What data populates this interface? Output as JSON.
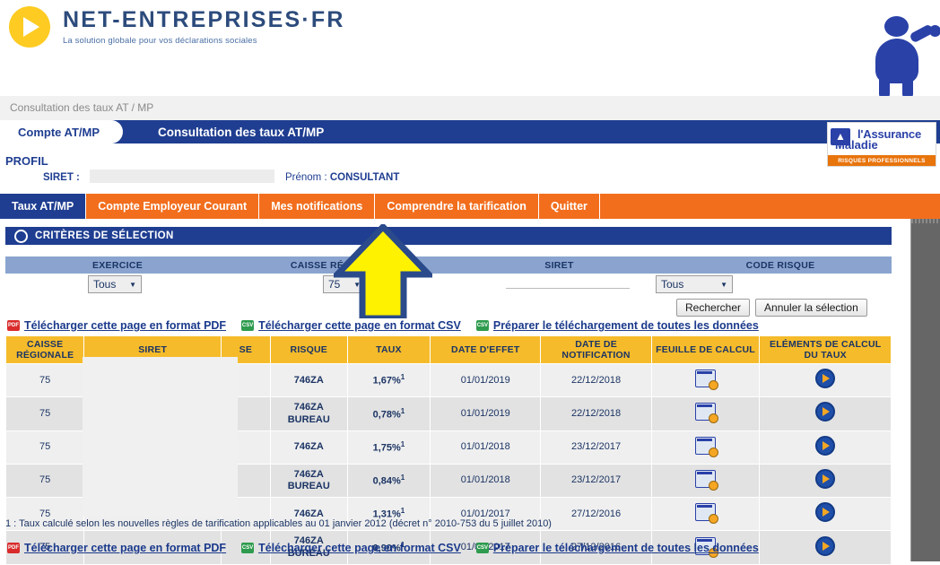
{
  "header": {
    "logo_title": "NET-ENTREPRISES·FR",
    "logo_subtitle": "La solution globale pour vos déclarations sociales",
    "logo_icon": "play-disc-icon",
    "mascot_icon": "blue-person-icon"
  },
  "breadcrumb": {
    "text": "Consultation des taux AT / MP"
  },
  "tabband": {
    "pill_label": "Compte AT/MP",
    "current_label": "Consultation des taux AT/MP"
  },
  "insurer_logo": {
    "line1": "l'Assurance",
    "line2": "Maladie",
    "tagline": "RISQUES PROFESSIONNELS",
    "mark_icon": "runner-icon"
  },
  "profile": {
    "title": "PROFIL",
    "siret_label": "SIRET :",
    "siret_value": "",
    "prenom_label": "Prénom : ",
    "prenom_value": "CONSULTANT"
  },
  "nav": {
    "items": [
      {
        "label": "Taux AT/MP",
        "active": true
      },
      {
        "label": "Compte Employeur Courant",
        "active": false
      },
      {
        "label": "Mes notifications",
        "active": false
      },
      {
        "label": "Comprendre la tarification",
        "active": false
      },
      {
        "label": "Quitter",
        "active": false
      }
    ]
  },
  "criteria": {
    "section_title": "CRITÈRES DE SÉLECTION",
    "section_icon": "circle-bullet-icon",
    "headers": [
      "EXERCICE",
      "CAISSE RÉGIONALE",
      "SIRET",
      "CODE RISQUE"
    ],
    "exercice_value": "Tous",
    "caisse_value": "75",
    "siret_value": "",
    "code_risque_value": "Tous",
    "caret_icon": "chevron-down-icon",
    "search_button": "Rechercher",
    "reset_button": "Annuler la sélection"
  },
  "downloads": {
    "pdf_label": "Télécharger cette page en format PDF",
    "csv_label": "Télécharger cette page en format CSV",
    "all_label": "Préparer le téléchargement de toutes les données",
    "pdf_icon": "pdf-file-icon",
    "csv_icon": "csv-file-icon",
    "all_icon": "csv-file-icon",
    "pdf_badge": "PDF",
    "csv_badge": "CSV"
  },
  "table": {
    "headers": [
      "CAISSE RÉGIONALE",
      "SIRET",
      "SE",
      "RISQUE",
      "TAUX",
      "DATE D'EFFET",
      "DATE DE NOTIFICATION",
      "FEUILLE DE CALCUL",
      "ELÉMENTS DE CALCUL DU TAUX"
    ],
    "rows": [
      {
        "caisse": "75",
        "siret": "",
        "se": "",
        "risque": "746ZA",
        "taux": "1,67%",
        "note": "1",
        "effet": "01/01/2019",
        "notif": "22/12/2018",
        "sheet_icon": "calc-sheet-icon",
        "detail_icon": "play-circle-icon"
      },
      {
        "caisse": "75",
        "siret": "",
        "se": "",
        "risque": "746ZA BUREAU",
        "taux": "0,78%",
        "note": "1",
        "effet": "01/01/2019",
        "notif": "22/12/2018",
        "sheet_icon": "calc-sheet-icon",
        "detail_icon": "play-circle-icon"
      },
      {
        "caisse": "75",
        "siret": "",
        "se": "",
        "risque": "746ZA",
        "taux": "1,75%",
        "note": "1",
        "effet": "01/01/2018",
        "notif": "23/12/2017",
        "sheet_icon": "calc-sheet-icon",
        "detail_icon": "play-circle-icon"
      },
      {
        "caisse": "75",
        "siret": "",
        "se": "",
        "risque": "746ZA BUREAU",
        "taux": "0,84%",
        "note": "1",
        "effet": "01/01/2018",
        "notif": "23/12/2017",
        "sheet_icon": "calc-sheet-icon",
        "detail_icon": "play-circle-icon"
      },
      {
        "caisse": "75",
        "siret": "",
        "se": "",
        "risque": "746ZA",
        "taux": "1,31%",
        "note": "1",
        "effet": "01/01/2017",
        "notif": "27/12/2016",
        "sheet_icon": "calc-sheet-icon",
        "detail_icon": "play-circle-icon"
      },
      {
        "caisse": "75",
        "siret": "",
        "se": "",
        "risque": "746ZA BUREAU",
        "taux": "0,90%",
        "note": "1",
        "effet": "01/01/2017",
        "notif": "27/12/2016",
        "sheet_icon": "calc-sheet-icon",
        "detail_icon": "play-circle-icon"
      }
    ]
  },
  "footnote": {
    "text": "1 : Taux calculé selon les nouvelles règles de tarification applicables au 01 janvier 2012 (décret n° 2010-753 du 5 juillet 2010)"
  },
  "annotation": {
    "arrow_icon": "up-arrow-annotation",
    "fill": "#FFF200",
    "stroke": "#2A4A8B",
    "points_at": "Mes notifications"
  },
  "colors": {
    "orange_nav": "#F26E1D",
    "blue_primary": "#1F3E91",
    "table_header": "#F5BB2B",
    "criteria_header": "#8AA4CF"
  }
}
